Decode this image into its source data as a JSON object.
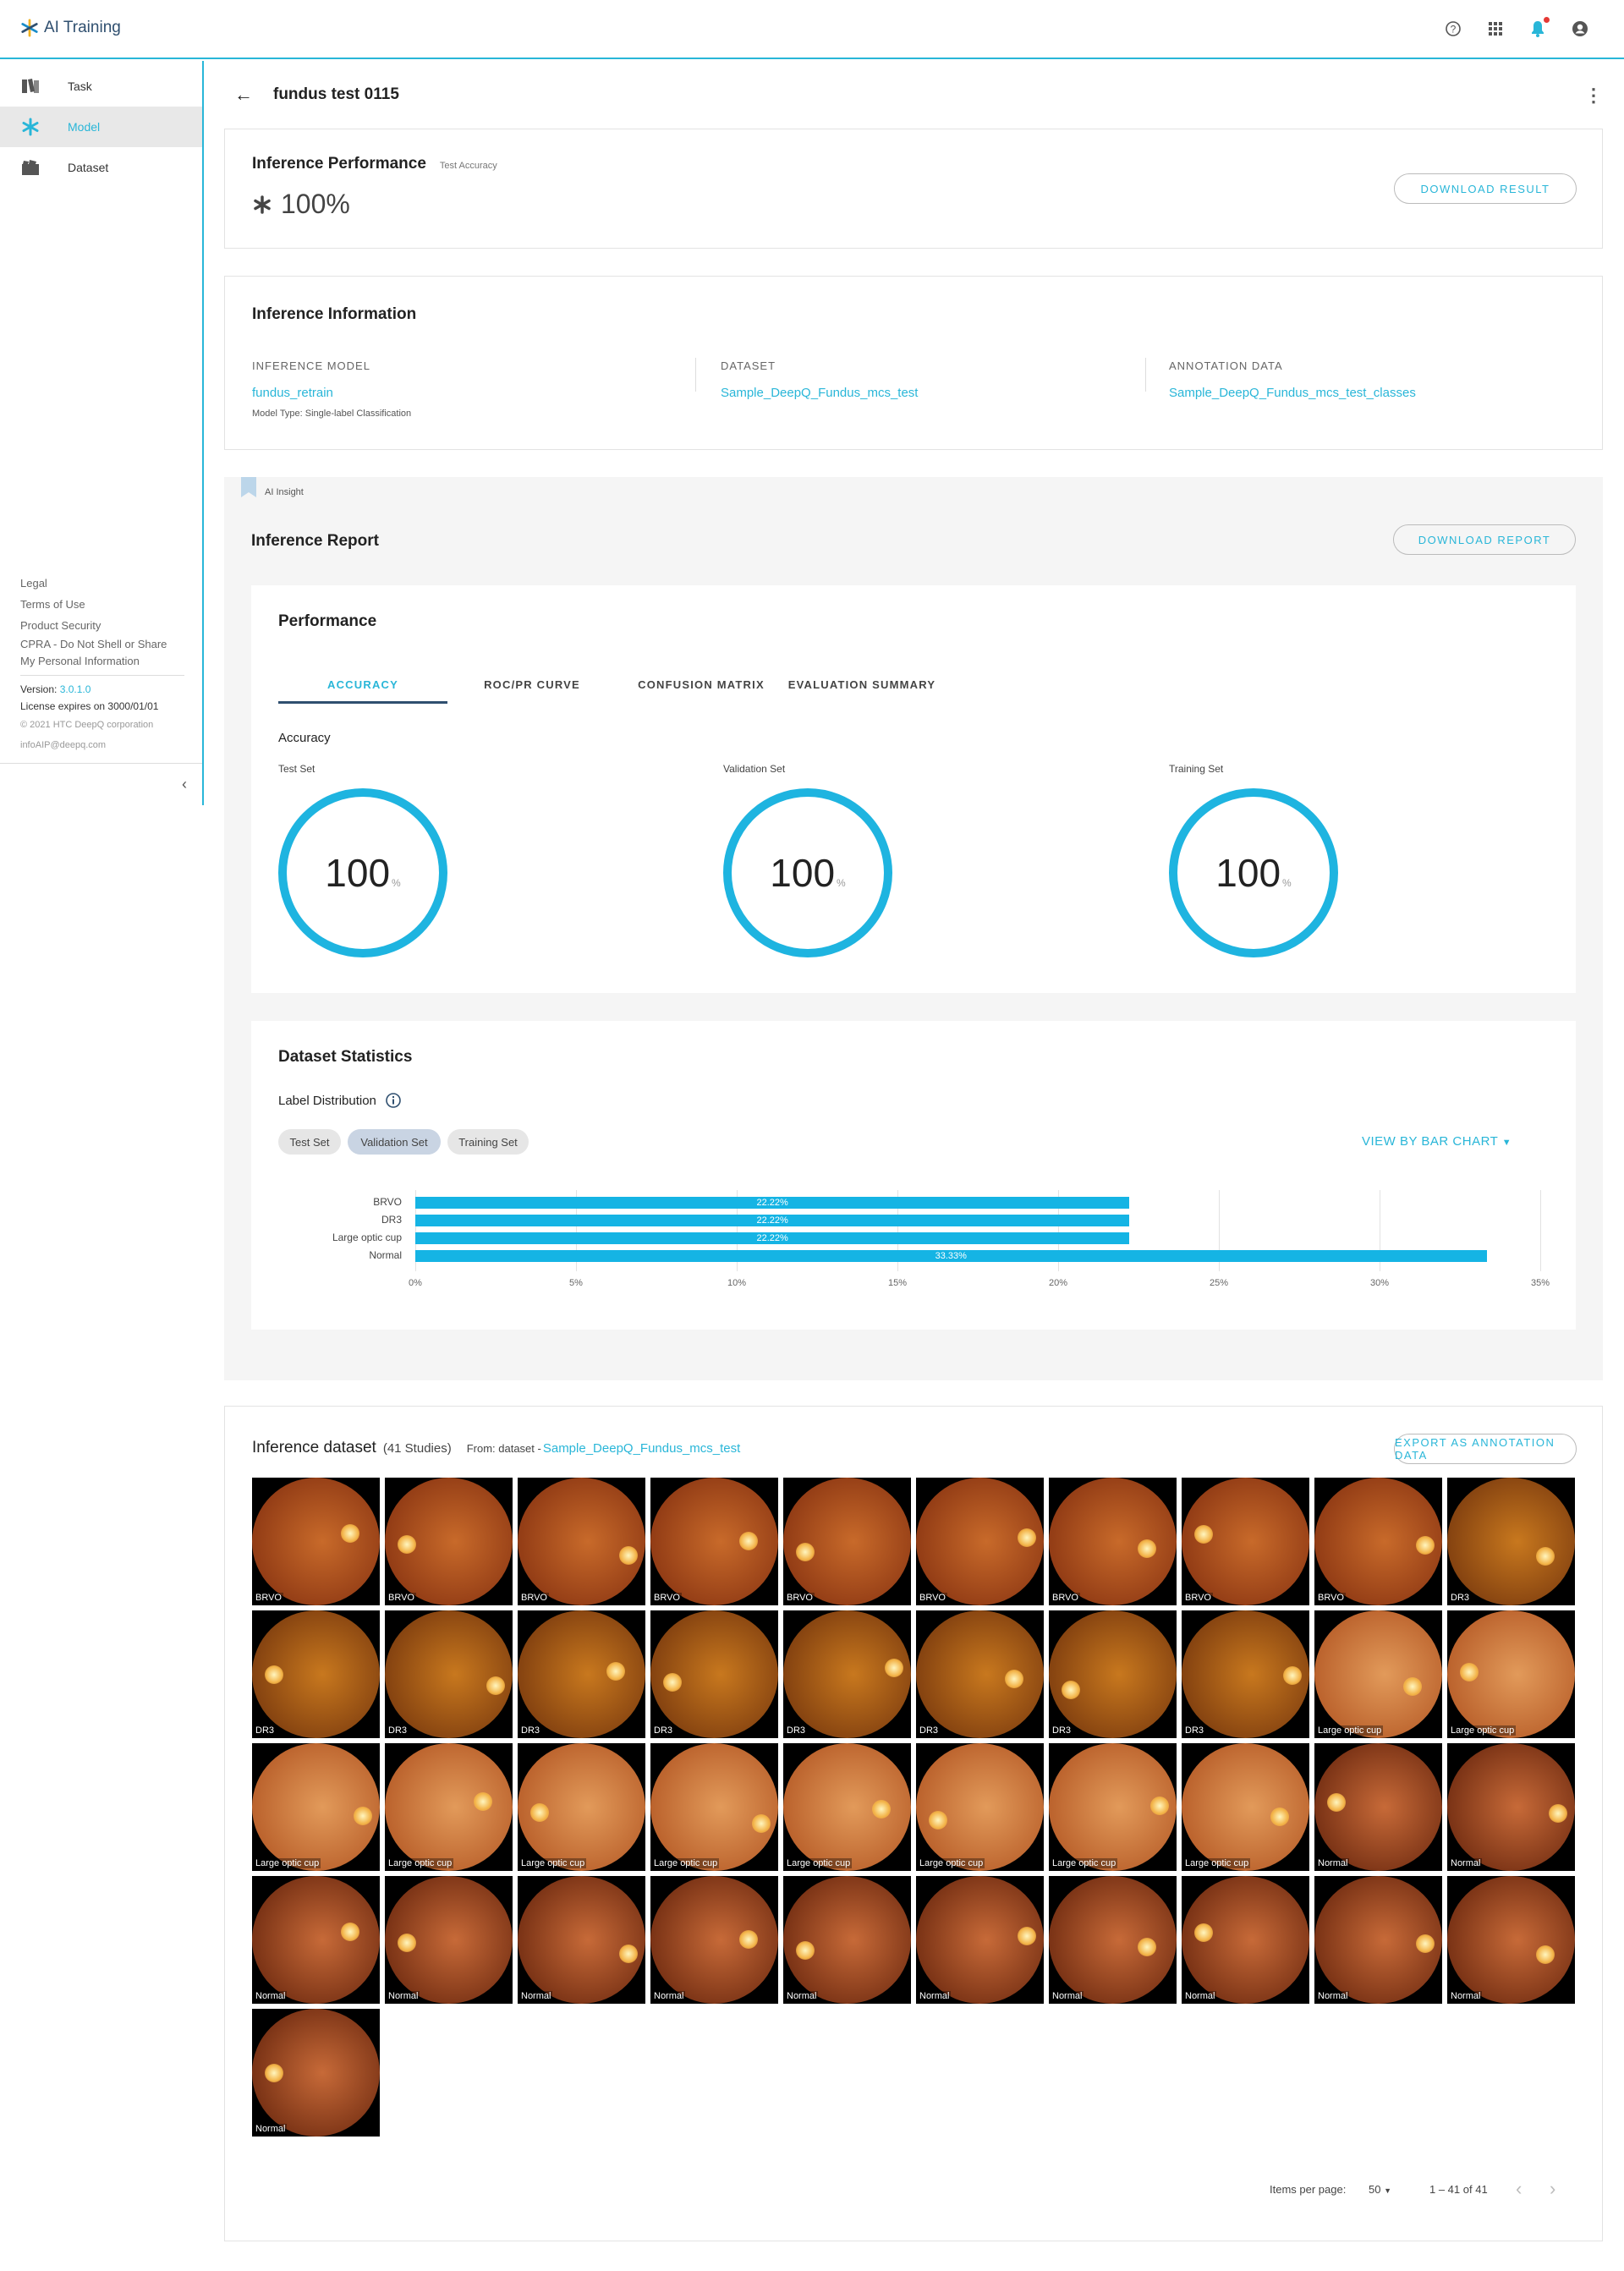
{
  "app": {
    "title": "AI Training"
  },
  "sidebar": {
    "items": [
      {
        "label": "Task"
      },
      {
        "label": "Model"
      },
      {
        "label": "Dataset"
      }
    ],
    "footer": {
      "legal": "Legal",
      "terms": "Terms of Use",
      "security": "Product Security",
      "cpra": "CPRA - Do Not Shell or Share My Personal Information",
      "version_label": "Version: ",
      "version": "3.0.1.0",
      "license": "License expires on 3000/01/01",
      "copyright": "© 2021 HTC DeepQ corporation",
      "email": "infoAIP@deepq.com"
    }
  },
  "page": {
    "title": "fundus test 0115"
  },
  "performance": {
    "title": "Inference Performance",
    "subtitle": "Test Accuracy",
    "value": "100%",
    "download": "DOWNLOAD RESULT"
  },
  "info": {
    "title": "Inference Information",
    "model_label": "INFERENCE MODEL",
    "model": "fundus_retrain",
    "model_type": "Model Type: Single-label Classification",
    "dataset_label": "DATASET",
    "dataset": "Sample_DeepQ_Fundus_mcs_test",
    "annotation_label": "ANNOTATION DATA",
    "annotation": "Sample_DeepQ_Fundus_mcs_test_classes"
  },
  "report": {
    "badge": "AI Insight",
    "title": "Inference Report",
    "download": "DOWNLOAD REPORT",
    "perf_title": "Performance",
    "tabs": [
      "ACCURACY",
      "ROC/PR CURVE",
      "CONFUSION MATRIX",
      "EVALUATION SUMMARY"
    ],
    "accuracy_title": "Accuracy",
    "rings": [
      {
        "label": "Test Set",
        "value": "100",
        "unit": "%"
      },
      {
        "label": "Validation Set",
        "value": "100",
        "unit": "%"
      },
      {
        "label": "Training Set",
        "value": "100",
        "unit": "%"
      }
    ]
  },
  "stats": {
    "title": "Dataset Statistics",
    "label_dist": "Label Distribution",
    "chips": [
      "Test Set",
      "Validation Set",
      "Training Set"
    ],
    "view": "VIEW BY BAR CHART"
  },
  "chart_data": {
    "type": "bar",
    "orientation": "horizontal",
    "categories": [
      "BRVO",
      "DR3",
      "Large optic cup",
      "Normal"
    ],
    "values": [
      22.22,
      22.22,
      22.22,
      33.33
    ],
    "value_labels": [
      "22.22%",
      "22.22%",
      "22.22%",
      "33.33%"
    ],
    "xlim": [
      0,
      35
    ],
    "xticks": [
      "0%",
      "5%",
      "10%",
      "15%",
      "20%",
      "25%",
      "30%",
      "35%"
    ],
    "grid": true
  },
  "dataset": {
    "title": "Inference dataset",
    "count": "(41 Studies)",
    "from": "From: dataset - ",
    "source": "Sample_DeepQ_Fundus_mcs_test",
    "export": "EXPORT AS ANNOTATION DATA",
    "labels": [
      "BRVO",
      "BRVO",
      "BRVO",
      "BRVO",
      "BRVO",
      "BRVO",
      "BRVO",
      "BRVO",
      "BRVO",
      "DR3",
      "DR3",
      "DR3",
      "DR3",
      "DR3",
      "DR3",
      "DR3",
      "DR3",
      "DR3",
      "Large optic cup",
      "Large optic cup",
      "Large optic cup",
      "Large optic cup",
      "Large optic cup",
      "Large optic cup",
      "Large optic cup",
      "Large optic cup",
      "Large optic cup",
      "Large optic cup",
      "Normal",
      "Normal",
      "Normal",
      "Normal",
      "Normal",
      "Normal",
      "Normal",
      "Normal",
      "Normal",
      "Normal",
      "Normal",
      "Normal",
      "Normal"
    ],
    "items_per_page_label": "Items per page:",
    "items_per_page": "50",
    "range": "1 – 41 of 41"
  },
  "colors": {
    "accent": "#29b6d8",
    "ring": "#1eb4e0",
    "bar": "#15b4e4"
  }
}
